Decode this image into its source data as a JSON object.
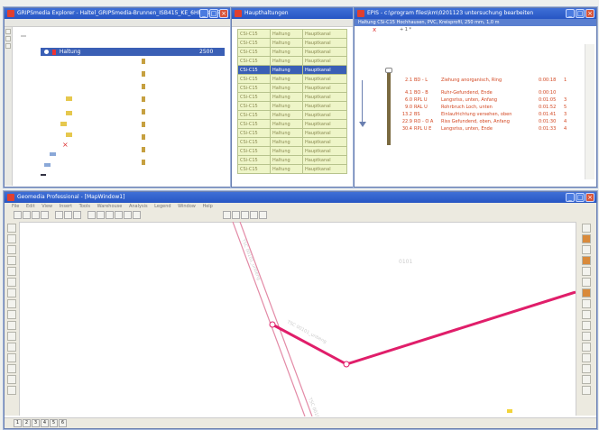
{
  "explorer": {
    "title": "GRIPSmedia Explorer - Haltel_GRIPSmedia-Brunnen_ISB415_KE_6HR Hau Te...",
    "root_node": "Haltung",
    "root_value": "2500"
  },
  "haltungen": {
    "title": "Haupthaltungen",
    "rows": [
      [
        "CSi-C15",
        "Haltung",
        "Hauptkanal"
      ],
      [
        "CSi-C15",
        "Haltung",
        "Hauptkanal"
      ],
      [
        "CSi-C15",
        "Haltung",
        "Hauptkanal"
      ],
      [
        "CSi-C15",
        "Haltung",
        "Hauptkanal"
      ],
      [
        "CSi-C15",
        "Haltung",
        "Hauptkanal"
      ],
      [
        "CSi-C15",
        "Haltung",
        "Hauptkanal"
      ],
      [
        "CSi-C15",
        "Haltung",
        "Hauptkanal"
      ],
      [
        "CSi-C15",
        "Haltung",
        "Hauptkanal"
      ],
      [
        "CSi-C15",
        "Haltung",
        "Hauptkanal"
      ],
      [
        "CSi-C15",
        "Haltung",
        "Hauptkanal"
      ],
      [
        "CSi-C15",
        "Haltung",
        "Hauptkanal"
      ],
      [
        "CSi-C15",
        "Haltung",
        "Hauptkanal"
      ],
      [
        "CSi-C15",
        "Haltung",
        "Hauptkanal"
      ],
      [
        "CSi-C15",
        "Haltung",
        "Hauptkanal"
      ],
      [
        "CSi-C15",
        "Haltung",
        "Hauptkanal"
      ],
      [
        "CSi-C15",
        "Haltung",
        "Hauptkanal"
      ]
    ]
  },
  "inspection": {
    "title": "EPIS - c:\\program files\\km\\0201123 untersuchung bearbeiten",
    "subtitle": "Haltung CSi-C15 Hochhausen, PVC, Kreisprofil, 250 mm, 1,0 m",
    "marker": "x",
    "readout": "+ 1 *",
    "entries": [
      {
        "pos": "2.1",
        "code": "BD - L",
        "desc": "Ziehung anorganisch, Ring",
        "time": "0:00:18",
        "n": "1"
      },
      {
        "pos": "4.1",
        "code": "BO - B",
        "desc": "Ruhr-Gefundend, Ende",
        "time": "0:00:10",
        "n": ""
      },
      {
        "pos": "6.0",
        "code": "RPL U",
        "desc": "Langsriss, unten, Anfang",
        "time": "0:01:05",
        "n": "3"
      },
      {
        "pos": "9.0",
        "code": "RAL U",
        "desc": "Rohrbruch Loch, unten",
        "time": "0:01:52",
        "n": "5"
      },
      {
        "pos": "13.2",
        "code": "BS",
        "desc": "Einlaufrichtung versehen, oben",
        "time": "0:01:41",
        "n": "3"
      },
      {
        "pos": "22.9",
        "code": "RO - O A",
        "desc": "Riss Gefundend, oben, Anfang",
        "time": "0:01:30",
        "n": "4"
      },
      {
        "pos": "30.4",
        "code": "RPL U E",
        "desc": "Langsriss, unten, Ende",
        "time": "0:01:33",
        "n": "4"
      }
    ]
  },
  "cad": {
    "title": "Geomedia Professional - [MapWindow1]",
    "menu": [
      "File",
      "Edit",
      "View",
      "Insert",
      "Tools",
      "Warehouse",
      "Analysis",
      "Legend",
      "Window",
      "Help"
    ],
    "labels": {
      "pipe1": "TSC 00101_unbeng",
      "pipe2": "TSC 00101_unbeng",
      "pipe3": "TSC 00101",
      "region": "0101"
    },
    "statusbar": [
      "1",
      "2",
      "3",
      "4",
      "5",
      "6"
    ]
  },
  "colors": {
    "titlebar": "#2756c4",
    "highlight": "#e01e6a",
    "pipe": "#e38aa6"
  }
}
